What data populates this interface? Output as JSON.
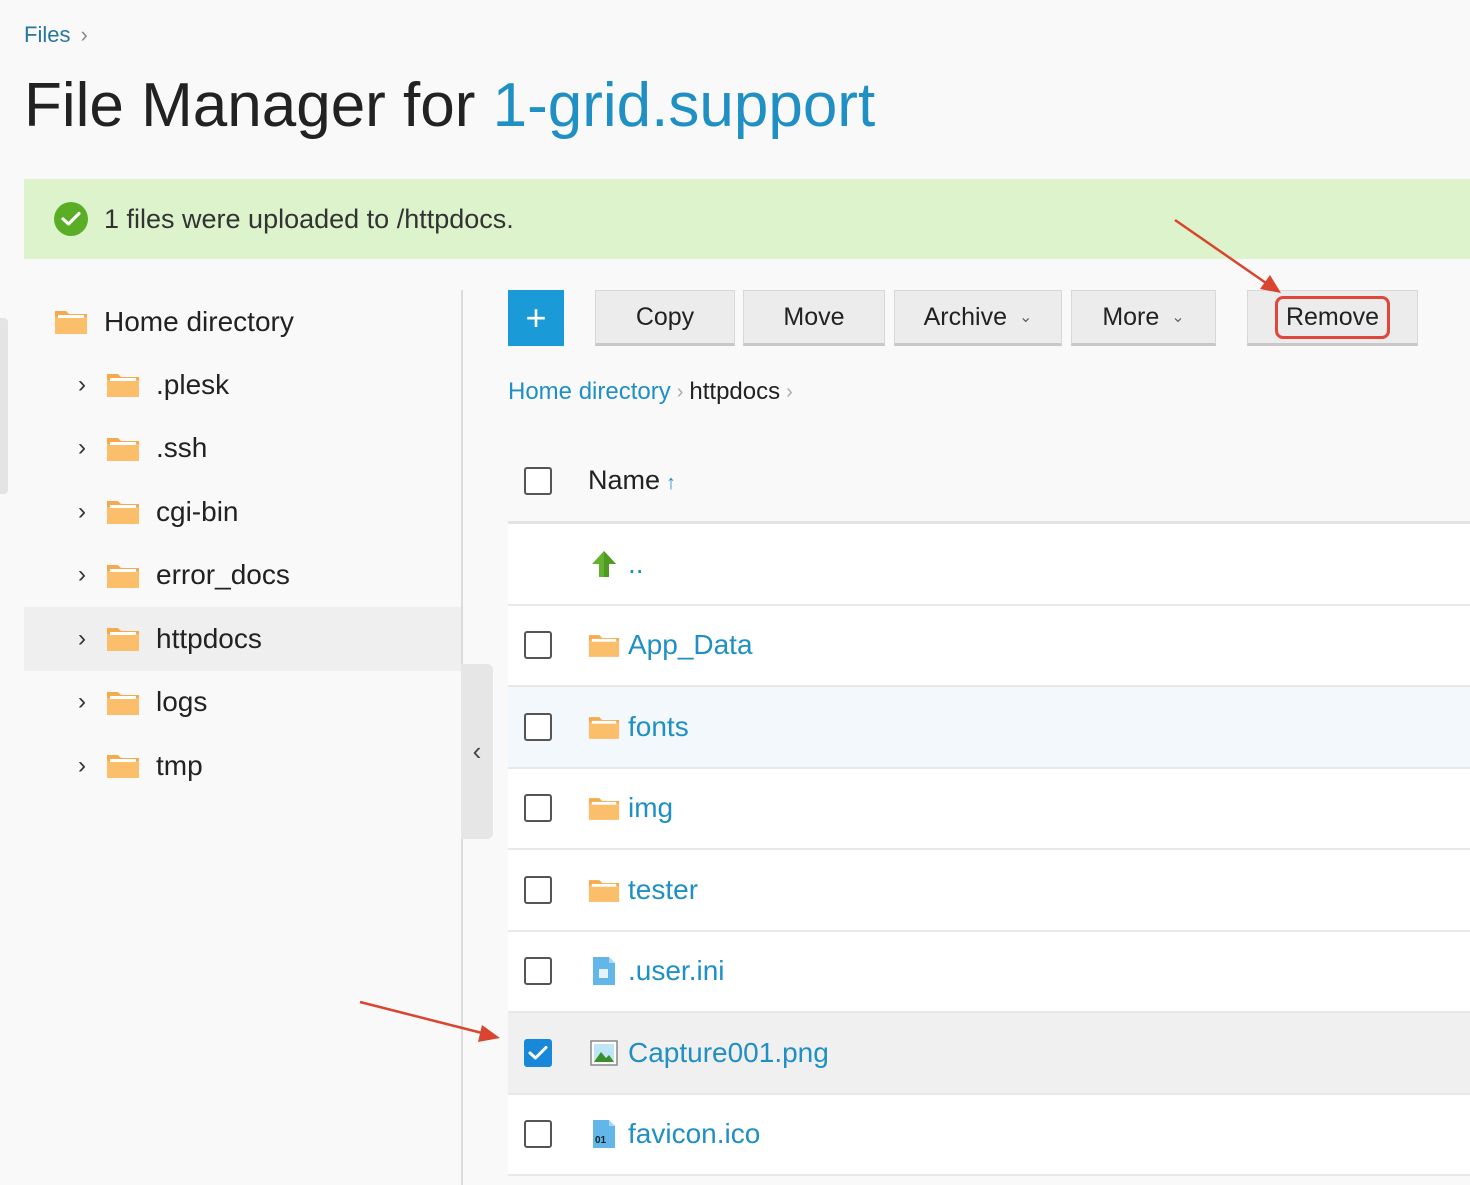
{
  "breadcrumb_top": {
    "files": "Files",
    "sep": ">"
  },
  "title": {
    "prefix": "File Manager for ",
    "domain": "1-grid.support"
  },
  "message": {
    "text": "1 files were uploaded to /httpdocs.",
    "color": "#dcf3cc"
  },
  "tree": {
    "root": "Home directory",
    "items": [
      {
        "label": ".plesk",
        "active": false
      },
      {
        "label": ".ssh",
        "active": false
      },
      {
        "label": "cgi-bin",
        "active": false
      },
      {
        "label": "error_docs",
        "active": false
      },
      {
        "label": "httpdocs",
        "active": true
      },
      {
        "label": "logs",
        "active": false
      },
      {
        "label": "tmp",
        "active": false
      }
    ]
  },
  "toolbar": {
    "add_label": "+",
    "copy_label": "Copy",
    "move_label": "Move",
    "archive_label": "Archive",
    "more_label": "More",
    "remove_label": "Remove"
  },
  "path": {
    "home": "Home directory",
    "current": "httpdocs"
  },
  "table": {
    "header_name": "Name",
    "sort_icon": "↑",
    "up_label": "..",
    "rows": [
      {
        "name": "App_Data",
        "type": "folder",
        "checked": false
      },
      {
        "name": "fonts",
        "type": "folder",
        "checked": false
      },
      {
        "name": "img",
        "type": "folder",
        "checked": false
      },
      {
        "name": "tester",
        "type": "folder",
        "checked": false
      },
      {
        "name": ".user.ini",
        "type": "file",
        "checked": false
      },
      {
        "name": "Capture001.png",
        "type": "image",
        "checked": true
      },
      {
        "name": "favicon.ico",
        "type": "binary",
        "checked": false
      }
    ]
  },
  "colors": {
    "accent": "#1f8fc4",
    "highlight": "#e0473a",
    "folder": "#f7a94b"
  }
}
